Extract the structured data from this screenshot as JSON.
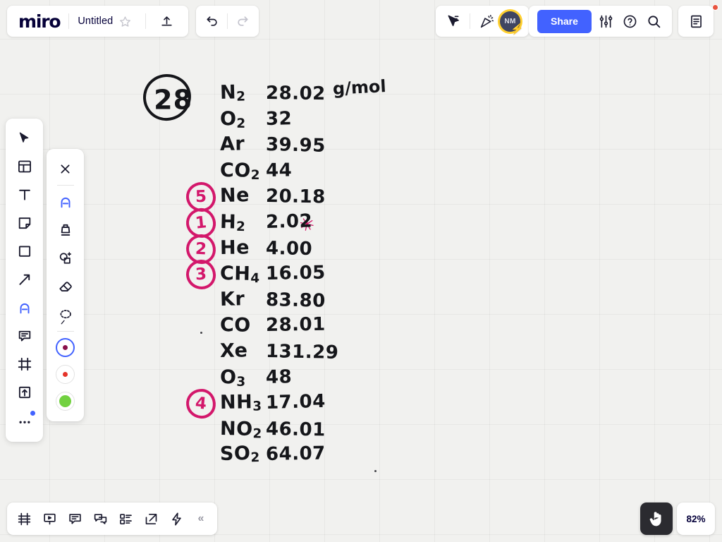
{
  "app": {
    "logo": "miro",
    "document_title": "Untitled",
    "zoom_level": "82%"
  },
  "topbar": {
    "star_icon": "star-icon",
    "upload_icon": "upload-icon",
    "undo_icon": "undo-icon",
    "redo_icon": "redo-icon",
    "cursor_share_icon": "cursor-pointer-icon",
    "celebrate_icon": "party-popper-icon",
    "avatar_initials": "NM",
    "avatar_bolt": "⚡",
    "share_label": "Share",
    "settings_icon": "sliders-icon",
    "help_icon": "help-circle-icon",
    "search_icon": "search-icon",
    "notes_icon": "notes-panel-icon"
  },
  "main_toolbar": {
    "items": [
      {
        "name": "select-tool",
        "icon": "cursor-icon",
        "active": false
      },
      {
        "name": "templates-tool",
        "icon": "templates-icon",
        "active": false
      },
      {
        "name": "text-tool",
        "icon": "text-icon",
        "active": false
      },
      {
        "name": "sticky-tool",
        "icon": "sticky-note-icon",
        "active": false
      },
      {
        "name": "shape-tool",
        "icon": "square-icon",
        "active": false
      },
      {
        "name": "arrow-tool",
        "icon": "arrow-icon",
        "active": false
      },
      {
        "name": "pen-tool",
        "icon": "pen-icon",
        "active": true
      },
      {
        "name": "comment-tool",
        "icon": "comment-icon",
        "active": false
      },
      {
        "name": "frame-tool",
        "icon": "frame-icon",
        "active": false
      },
      {
        "name": "upload-tool",
        "icon": "upload-box-icon",
        "active": false
      },
      {
        "name": "more-tools",
        "icon": "ellipsis-icon",
        "active": false
      }
    ]
  },
  "pen_toolbar": {
    "close_icon": "close-icon",
    "items": [
      {
        "name": "pen-stroke",
        "icon": "pen-icon",
        "active": true
      },
      {
        "name": "marker-stroke",
        "icon": "marker-icon",
        "active": false
      },
      {
        "name": "smart-draw",
        "icon": "smart-shape-icon",
        "active": false
      },
      {
        "name": "eraser",
        "icon": "eraser-icon",
        "active": false
      },
      {
        "name": "lasso-select",
        "icon": "lasso-icon",
        "active": false
      }
    ],
    "colors": [
      {
        "name": "color-magenta",
        "hex": "#8a0f4a",
        "selected": true,
        "filled": false
      },
      {
        "name": "color-red",
        "hex": "#e5342a",
        "selected": false,
        "filled": false
      },
      {
        "name": "color-green",
        "hex": "#72d140",
        "selected": false,
        "filled": true
      }
    ]
  },
  "bottom_bar": {
    "items": [
      {
        "name": "frames-panel-button",
        "icon": "frames-icon"
      },
      {
        "name": "presentation-button",
        "icon": "presentation-icon"
      },
      {
        "name": "comments-button",
        "icon": "comment-bubble-icon"
      },
      {
        "name": "chat-button",
        "icon": "chat-icon"
      },
      {
        "name": "cards-button",
        "icon": "cards-list-icon"
      },
      {
        "name": "export-button",
        "icon": "export-icon"
      },
      {
        "name": "apps-button",
        "icon": "lightning-icon"
      }
    ],
    "collapse_label": "«"
  },
  "canvas": {
    "circled_note": "28",
    "unit_label": "g/mol",
    "star_mark": "✳",
    "rows": [
      {
        "formula": "N",
        "sub": "2",
        "value": "28.02",
        "rank": null
      },
      {
        "formula": "O",
        "sub": "2",
        "value": "32",
        "rank": null
      },
      {
        "formula": "Ar",
        "sub": "",
        "value": "39.95",
        "rank": null
      },
      {
        "formula": "CO",
        "sub": "2",
        "value": "44",
        "rank": null
      },
      {
        "formula": "Ne",
        "sub": "",
        "value": "20.18",
        "rank": "5"
      },
      {
        "formula": "H",
        "sub": "2",
        "value": "2.02",
        "rank": "1"
      },
      {
        "formula": "He",
        "sub": "",
        "value": "4.00",
        "rank": "2"
      },
      {
        "formula": "CH",
        "sub": "4",
        "value": "16.05",
        "rank": "3"
      },
      {
        "formula": "Kr",
        "sub": "",
        "value": "83.80",
        "rank": null
      },
      {
        "formula": "CO",
        "sub": "",
        "value": "28.01",
        "rank": null
      },
      {
        "formula": "Xe",
        "sub": "",
        "value": "131.29",
        "rank": null
      },
      {
        "formula": "O",
        "sub": "3",
        "value": "48",
        "rank": null
      },
      {
        "formula": "NH",
        "sub": "3",
        "value": "17.04",
        "rank": "4"
      },
      {
        "formula": "NO",
        "sub": "2",
        "value": "46.01",
        "rank": null
      },
      {
        "formula": "SO",
        "sub": "2",
        "value": "64.07",
        "rank": null
      }
    ]
  }
}
